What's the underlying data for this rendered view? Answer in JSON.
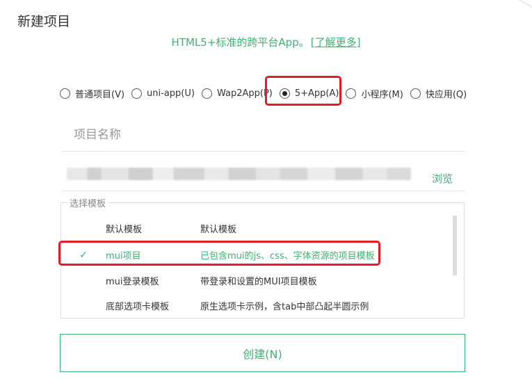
{
  "dialog": {
    "title": "新建项目",
    "subtitle": "HTML5+标准的跨平台App。",
    "more_link": "[了解更多]"
  },
  "project_types": [
    {
      "label": "普通项目(V)",
      "selected": false
    },
    {
      "label": "uni-app(U)",
      "selected": false
    },
    {
      "label": "Wap2App(P)",
      "selected": false
    },
    {
      "label": "5+App(A)",
      "selected": true
    },
    {
      "label": "小程序(M)",
      "selected": false
    },
    {
      "label": "快应用(Q)",
      "selected": false
    }
  ],
  "project_name": {
    "placeholder": "项目名称",
    "value": ""
  },
  "location": {
    "browse_label": "浏览"
  },
  "templates": {
    "legend": "选择模板",
    "items": [
      {
        "name": "默认模板",
        "desc": "默认模板",
        "selected": false
      },
      {
        "name": "mui项目",
        "desc": "已包含mui的js、css、字体资源的项目模板",
        "selected": true
      },
      {
        "name": "mui登录模板",
        "desc": "带登录和设置的MUI项目模板",
        "selected": false
      },
      {
        "name": "底部选项卡模板",
        "desc": "原生选项卡示例，含tab中部凸起半圆示例",
        "selected": false
      }
    ]
  },
  "create_button": {
    "label": "创建(N)"
  },
  "colors": {
    "accent": "#3cb371",
    "highlight": "#e51b23"
  }
}
